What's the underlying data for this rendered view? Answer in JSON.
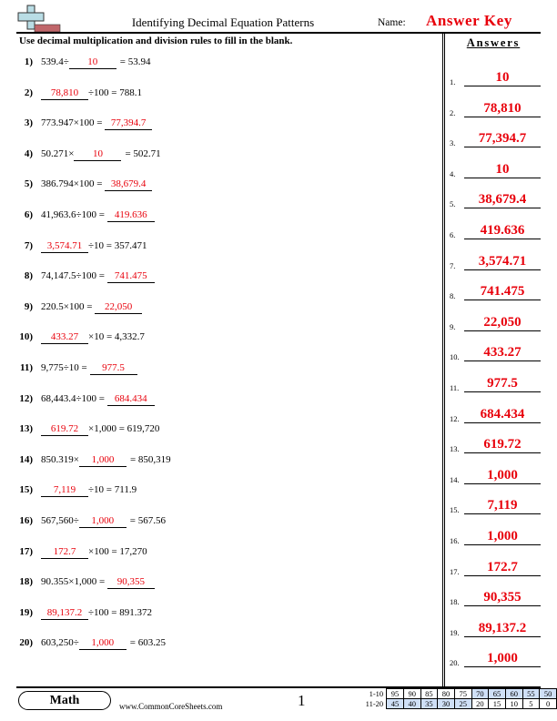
{
  "header": {
    "title": "Identifying Decimal Equation Patterns",
    "name_label": "Name:",
    "answer_key": "Answer Key",
    "logo_icon": "plus-minus-logo-icon"
  },
  "instructions": "Use decimal multiplication and division rules to fill in the blank.",
  "questions": [
    {
      "num": "1)",
      "before": "539.4÷",
      "blank": "10",
      "after": "= 53.94"
    },
    {
      "num": "2)",
      "before": "",
      "blank": "78,810",
      "after": "÷100 = 788.1"
    },
    {
      "num": "3)",
      "before": "773.947×100 = ",
      "blank": "77,394.7",
      "after": ""
    },
    {
      "num": "4)",
      "before": "50.271×",
      "blank": "10",
      "after": "= 502.71"
    },
    {
      "num": "5)",
      "before": "386.794×100 = ",
      "blank": "38,679.4",
      "after": ""
    },
    {
      "num": "6)",
      "before": "41,963.6÷100 = ",
      "blank": "419.636",
      "after": ""
    },
    {
      "num": "7)",
      "before": "",
      "blank": "3,574.71",
      "after": "÷10 = 357.471"
    },
    {
      "num": "8)",
      "before": "74,147.5÷100 = ",
      "blank": "741.475",
      "after": ""
    },
    {
      "num": "9)",
      "before": "220.5×100 = ",
      "blank": "22,050",
      "after": ""
    },
    {
      "num": "10)",
      "before": "",
      "blank": "433.27",
      "after": "×10 = 4,332.7"
    },
    {
      "num": "11)",
      "before": "9,775÷10 = ",
      "blank": "977.5",
      "after": ""
    },
    {
      "num": "12)",
      "before": "68,443.4÷100 = ",
      "blank": "684.434",
      "after": ""
    },
    {
      "num": "13)",
      "before": "",
      "blank": "619.72",
      "after": "×1,000 = 619,720"
    },
    {
      "num": "14)",
      "before": "850.319×",
      "blank": "1,000",
      "after": "= 850,319"
    },
    {
      "num": "15)",
      "before": "",
      "blank": "7,119",
      "after": "÷10 = 711.9"
    },
    {
      "num": "16)",
      "before": "567,560÷",
      "blank": "1,000",
      "after": "= 567.56"
    },
    {
      "num": "17)",
      "before": "",
      "blank": "172.7",
      "after": "×100 = 17,270"
    },
    {
      "num": "18)",
      "before": "90.355×1,000 = ",
      "blank": "90,355",
      "after": ""
    },
    {
      "num": "19)",
      "before": "",
      "blank": "89,137.2",
      "after": "÷100 = 891.372"
    },
    {
      "num": "20)",
      "before": "603,250÷",
      "blank": "1,000",
      "after": "= 603.25"
    }
  ],
  "answers": {
    "title": "Answers",
    "items": [
      {
        "num": "1.",
        "value": "10"
      },
      {
        "num": "2.",
        "value": "78,810"
      },
      {
        "num": "3.",
        "value": "77,394.7"
      },
      {
        "num": "4.",
        "value": "10"
      },
      {
        "num": "5.",
        "value": "38,679.4"
      },
      {
        "num": "6.",
        "value": "419.636"
      },
      {
        "num": "7.",
        "value": "3,574.71"
      },
      {
        "num": "8.",
        "value": "741.475"
      },
      {
        "num": "9.",
        "value": "22,050"
      },
      {
        "num": "10.",
        "value": "433.27"
      },
      {
        "num": "11.",
        "value": "977.5"
      },
      {
        "num": "12.",
        "value": "684.434"
      },
      {
        "num": "13.",
        "value": "619.72"
      },
      {
        "num": "14.",
        "value": "1,000"
      },
      {
        "num": "15.",
        "value": "7,119"
      },
      {
        "num": "16.",
        "value": "1,000"
      },
      {
        "num": "17.",
        "value": "172.7"
      },
      {
        "num": "18.",
        "value": "90,355"
      },
      {
        "num": "19.",
        "value": "89,137.2"
      },
      {
        "num": "20.",
        "value": "1,000"
      }
    ]
  },
  "footer": {
    "subject": "Math",
    "site": "www.CommonCoreSheets.com",
    "page": "1",
    "score_rows": [
      {
        "label": "1-10",
        "scores": [
          "95",
          "90",
          "85",
          "80",
          "75",
          "70",
          "65",
          "60",
          "55",
          "50"
        ],
        "highlight": [
          false,
          false,
          false,
          false,
          false,
          true,
          true,
          true,
          true,
          true
        ]
      },
      {
        "label": "11-20",
        "scores": [
          "45",
          "40",
          "35",
          "30",
          "25",
          "20",
          "15",
          "10",
          "5",
          "0"
        ],
        "highlight": [
          true,
          true,
          true,
          true,
          true,
          false,
          false,
          false,
          false,
          false
        ]
      }
    ]
  },
  "colors": {
    "answer_red": "#e8000b",
    "score_highlight": "#cfe0f7"
  }
}
